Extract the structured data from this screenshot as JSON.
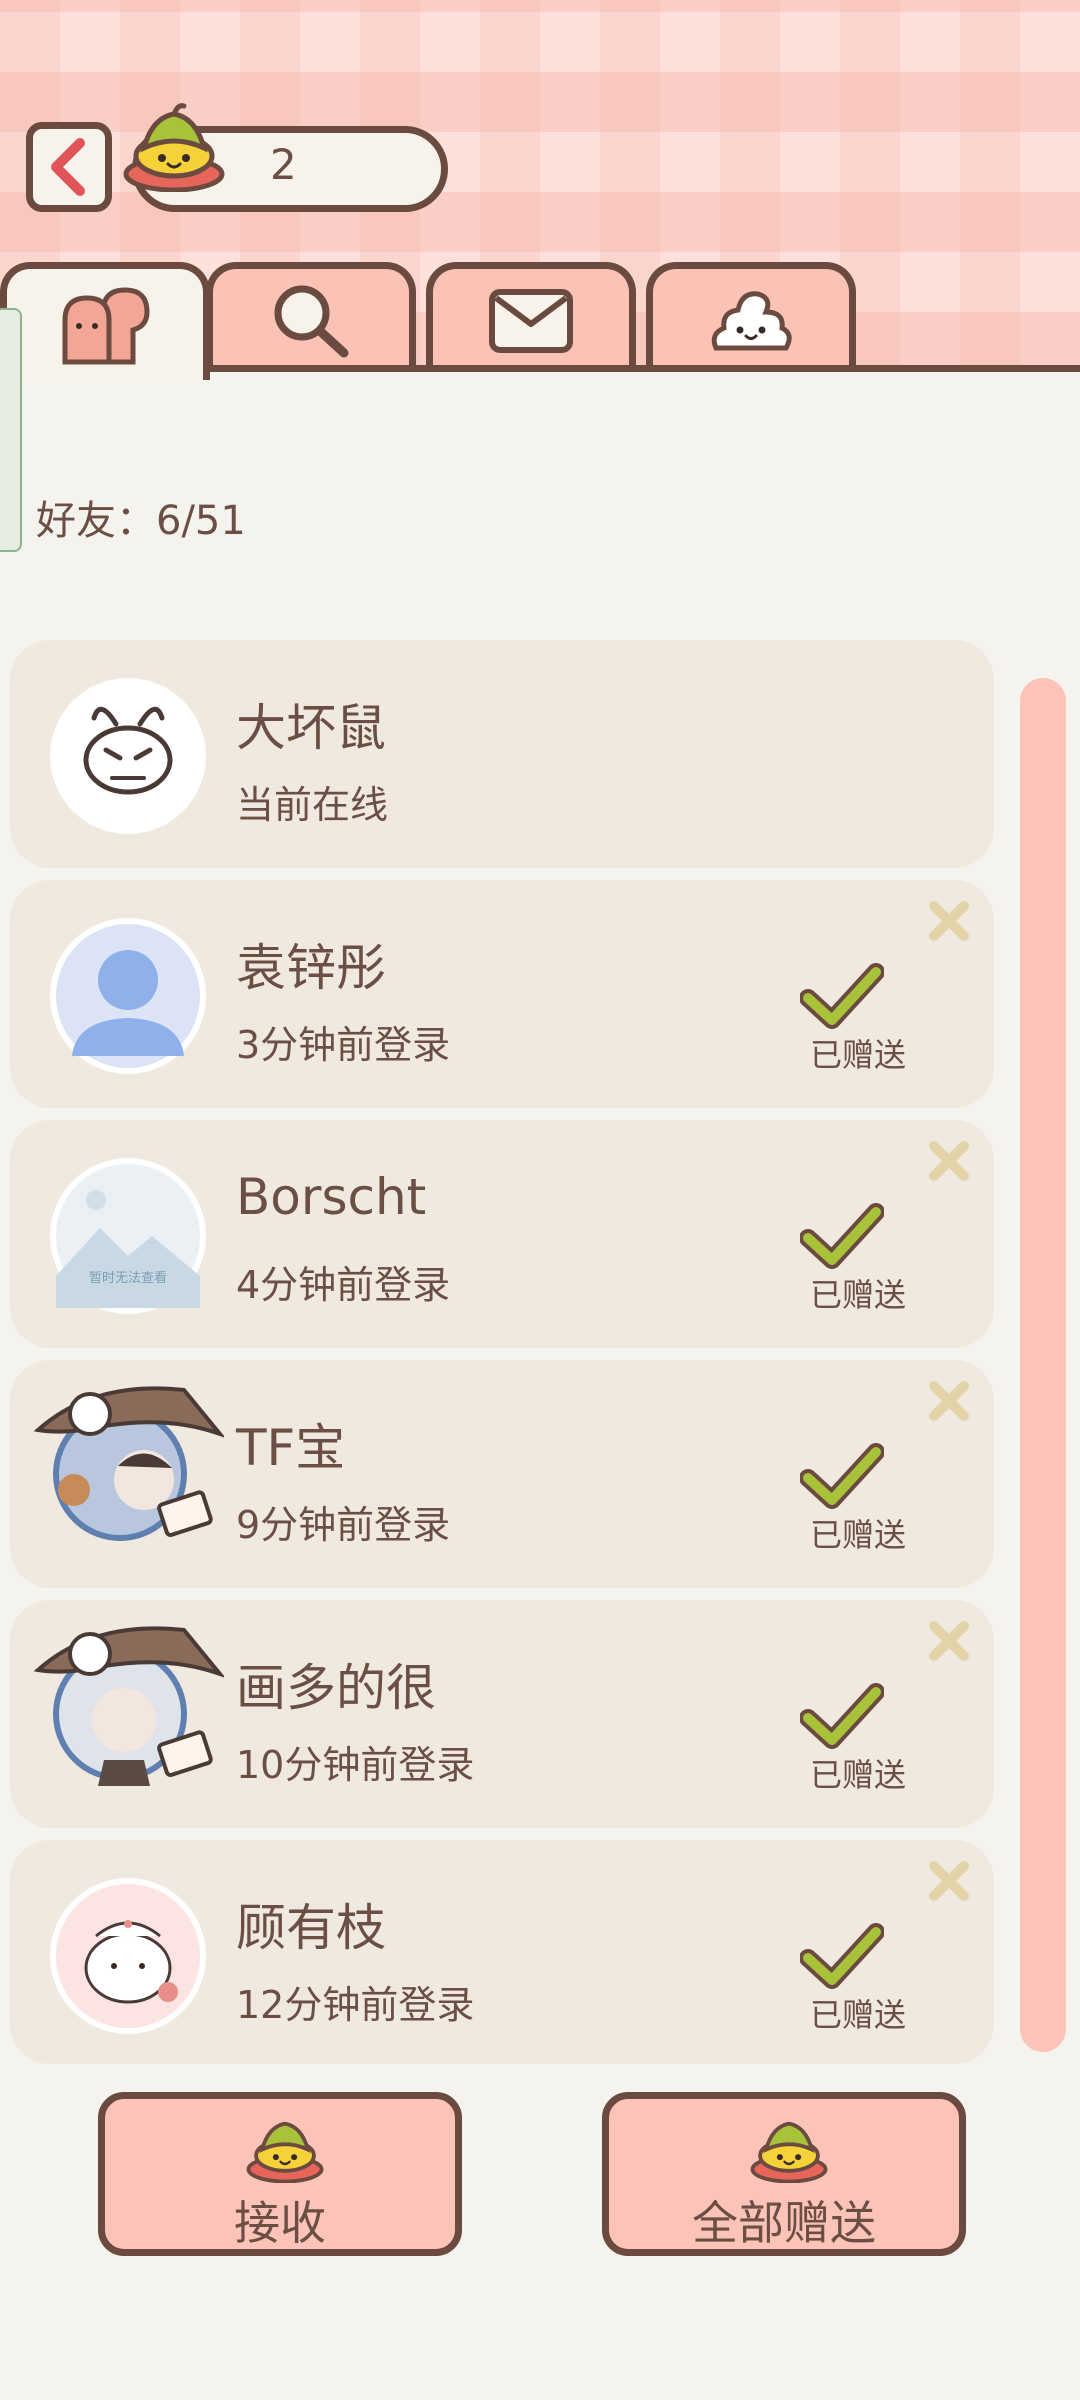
{
  "header": {
    "counter_value": "2"
  },
  "tabs": [
    {
      "icon": "friends-icon",
      "active": true
    },
    {
      "icon": "search-icon",
      "active": false
    },
    {
      "icon": "mail-icon",
      "active": false
    },
    {
      "icon": "poop-icon",
      "active": false
    }
  ],
  "friends_count_label": "好友：6/51",
  "friends": [
    {
      "name": "大坏鼠",
      "status": "当前在线",
      "gift_label": "",
      "avatar": "bunny-sketch-avatar"
    },
    {
      "name": "袁锌彤",
      "status": "3分钟前登录",
      "gift_label": "已赠送",
      "avatar": "default-person-avatar"
    },
    {
      "name": "Borscht",
      "status": "4分钟前登录",
      "gift_label": "已赠送",
      "avatar": "image-unavailable-avatar",
      "avatar_text": "暂时无法查看"
    },
    {
      "name": "TF宝",
      "status": "9分钟前登录",
      "gift_label": "已赠送",
      "avatar": "hat-character-avatar"
    },
    {
      "name": "画多的很",
      "status": "10分钟前登录",
      "gift_label": "已赠送",
      "avatar": "hat-character-avatar"
    },
    {
      "name": "顾有枝",
      "status": "12分钟前登录",
      "gift_label": "已赠送",
      "avatar": "cat-chef-avatar"
    }
  ],
  "buttons": {
    "receive_label": "接收",
    "gift_all_label": "全部赠送"
  },
  "colors": {
    "accent_pink": "#fcc3b8",
    "outline_brown": "#6b4a40",
    "check_green": "#a8c23a",
    "card_bg": "#f0e9df"
  }
}
